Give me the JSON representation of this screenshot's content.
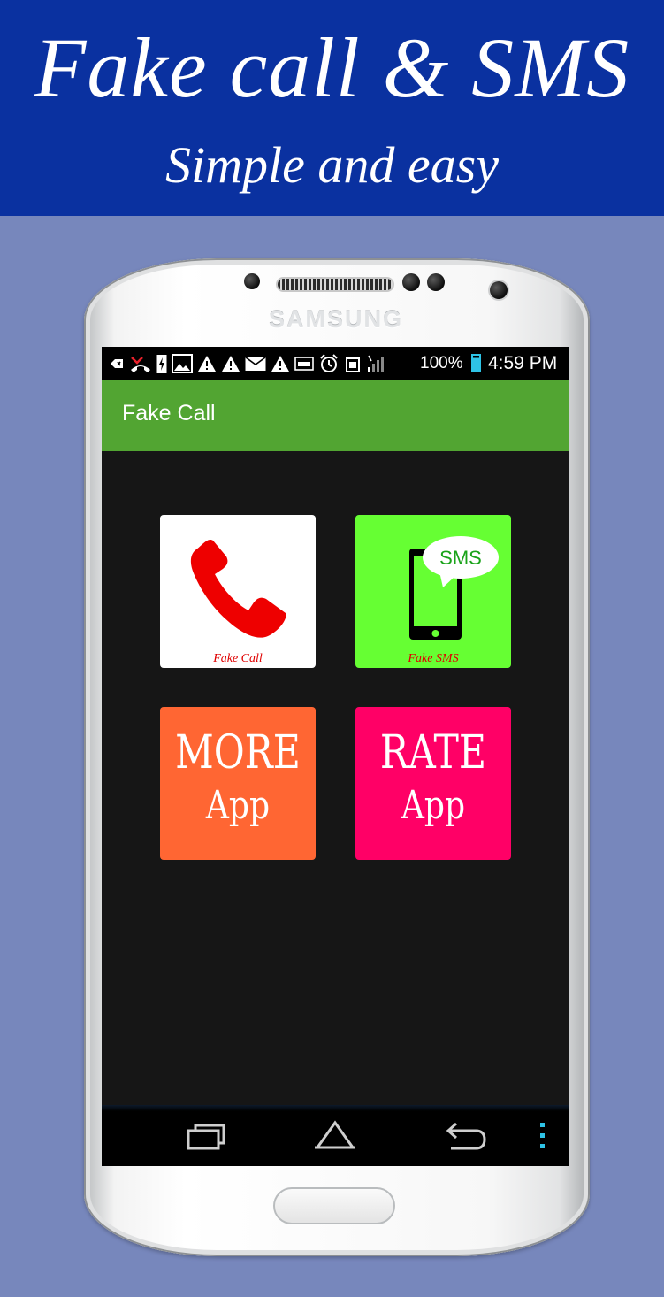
{
  "banner": {
    "title": "Fake call & SMS",
    "subtitle": "Simple and easy",
    "background": "#0a31a0"
  },
  "device": {
    "brand": "SAMSUNG"
  },
  "status_bar": {
    "notification_icons": [
      "usb-debug-icon",
      "missed-call-icon",
      "charging-icon",
      "gallery-icon",
      "warning-icon",
      "warning-icon",
      "email-icon",
      "warning-icon",
      "nfc-icon",
      "alarm-icon",
      "screenshot-icon",
      "signal-icon"
    ],
    "battery_level": "100%",
    "time": "4:59 PM",
    "accent": "#2ec3e6"
  },
  "action_bar": {
    "title": "Fake Call",
    "color": "#52a532"
  },
  "tiles": {
    "fake_call": {
      "caption": "Fake Call",
      "icon": "phone-handset-icon",
      "background": "#ffffff",
      "icon_color": "#ee0000"
    },
    "fake_sms": {
      "caption": "Fake SMS",
      "bubble_text": "SMS",
      "icon": "smartphone-icon",
      "background": "#66ff33"
    },
    "more_app": {
      "line1": "MORE",
      "line2": "App",
      "background": "#ff6633"
    },
    "rate_app": {
      "line1": "RATE",
      "line2": "App",
      "background": "#ff0066"
    }
  },
  "nav_bar": {
    "buttons": [
      "recent-apps-icon",
      "home-icon",
      "back-icon",
      "overflow-menu-icon"
    ]
  }
}
